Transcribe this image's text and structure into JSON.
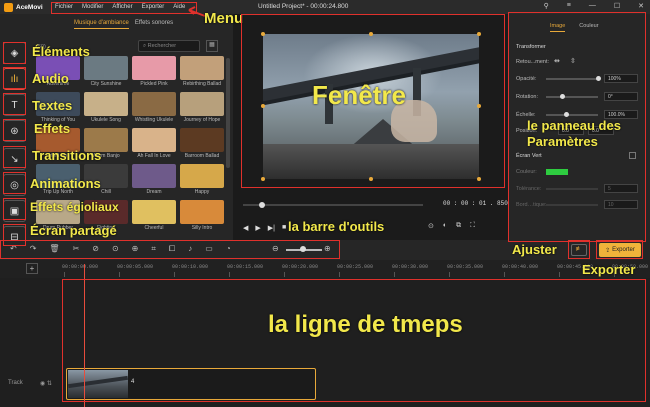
{
  "app": {
    "name": "AceMovi",
    "title": "Untitled Project* - 00:00:24.800",
    "menu": [
      "Fichier",
      "Modifier",
      "Afficher",
      "Exporter",
      "Aide"
    ]
  },
  "left_toolbar": {
    "items": [
      {
        "id": "elements",
        "icon": "layers-icon"
      },
      {
        "id": "audio",
        "icon": "waveform-icon"
      },
      {
        "id": "textes",
        "icon": "text-icon"
      },
      {
        "id": "effets",
        "icon": "effects-icon"
      },
      {
        "id": "transitions",
        "icon": "transition-icon"
      },
      {
        "id": "animations",
        "icon": "animation-icon"
      },
      {
        "id": "effets-speciaux",
        "icon": "special-effects-icon"
      },
      {
        "id": "ecran-partage",
        "icon": "split-screen-icon"
      }
    ]
  },
  "library": {
    "tabs": [
      "Musique d'ambiance",
      "Effets sonores"
    ],
    "active_tab": 0,
    "count_label": "(50)",
    "search_placeholder": "Rechercher",
    "items": [
      {
        "label": "Advertime",
        "color": "#7a4fb5"
      },
      {
        "label": "City Sunshine",
        "color": "#6b7a82"
      },
      {
        "label": "Pickled Pink",
        "color": "#e79aa8"
      },
      {
        "label": "Rebirthing Ballad",
        "color": "#c2a07a"
      },
      {
        "label": "Thinking of You",
        "color": "#3d4a5a"
      },
      {
        "label": "Ukulele Song",
        "color": "#c7b089"
      },
      {
        "label": "Whistling Ukulele",
        "color": "#8a6a44"
      },
      {
        "label": "Journey of Hope",
        "color": "#b7a07c"
      },
      {
        "label": "Hold On",
        "color": "#a65a2e"
      },
      {
        "label": "Warm Banjo",
        "color": "#9c7a4a"
      },
      {
        "label": "Ah Fall In Love",
        "color": "#d9b38a"
      },
      {
        "label": "Barroom Ballad",
        "color": "#5c3a22"
      },
      {
        "label": "Trip Up North",
        "color": "#4a5f6e"
      },
      {
        "label": "Chill",
        "color": "#3b3b3b"
      },
      {
        "label": "Dream",
        "color": "#6e5a8a"
      },
      {
        "label": "Happy",
        "color": "#d6a84a"
      },
      {
        "label": "Drum Rubber",
        "color": "#b8a888"
      },
      {
        "label": "Fighting",
        "color": "#5a2a2a"
      },
      {
        "label": "Cheerful",
        "color": "#e0c060"
      },
      {
        "label": "Silly Intro",
        "color": "#d88a3a"
      }
    ]
  },
  "preview": {
    "timecode": "00 : 00 : 01 . 850",
    "aspect": "16:9",
    "playback": [
      "play-icon",
      "next-frame-icon",
      "stop-icon"
    ]
  },
  "properties": {
    "tabs": [
      "Image",
      "Couleur"
    ],
    "section": "Transformer",
    "retournement": "Retou...ment:",
    "opacite_label": "Opacité:",
    "opacite_value": "100%",
    "opacite_level": 1.0,
    "rotation_label": "Rotation:",
    "rotation_value": "0°",
    "echelle_label": "Échelle:",
    "echelle_value": "100.0%",
    "position_label": "Position:",
    "position_x": "0.0",
    "position_y": "0.0",
    "ecran_vert_label": "Écran Vert",
    "couleur_label": "Couleur:",
    "green_color": "#2ecc40",
    "tolerance_label": "Tolérance:",
    "tolerance_value": "5",
    "bord_label": "Bord…tique:",
    "bord_value": "10",
    "ecran_vert_checked": false
  },
  "mid_toolbar": {
    "export_label": "Exporter",
    "icons": [
      "undo-icon",
      "redo-icon",
      "delete-icon",
      "cut-icon",
      "split-icon",
      "marker-icon",
      "crop-icon",
      "transform-icon",
      "mic-icon",
      "freeze-icon",
      "speed-icon",
      "zoom-out-icon",
      "zoom-in-icon"
    ]
  },
  "timeline": {
    "ticks": [
      "00:00:00.000",
      "00:00:05.000",
      "00:00:10.000",
      "00:00:15.000",
      "00:00:20.000",
      "00:00:25.000",
      "00:00:30.000",
      "00:00:35.000",
      "00:00:40.000",
      "00:00:45.000",
      "00:00:50.000"
    ],
    "track_label": "Track",
    "clip_count": "4"
  },
  "annotations": {
    "menu": "Menu",
    "elements": "Éléments",
    "audio": "Audio",
    "textes": "Textes",
    "effets": "Effets",
    "transitions": "Transitions",
    "animations": "Animations",
    "effets_speciaux": "Effets égioliaux",
    "ecran_partage": "Écran partagé",
    "fenetre": "Fenêtre",
    "panneau": "le panneau des Paramètres",
    "barre_outils": "la barre d'outils",
    "ajuster": "Ajuster",
    "exporter": "Exporter",
    "ligne_temps": "la ligne de tmeps"
  }
}
